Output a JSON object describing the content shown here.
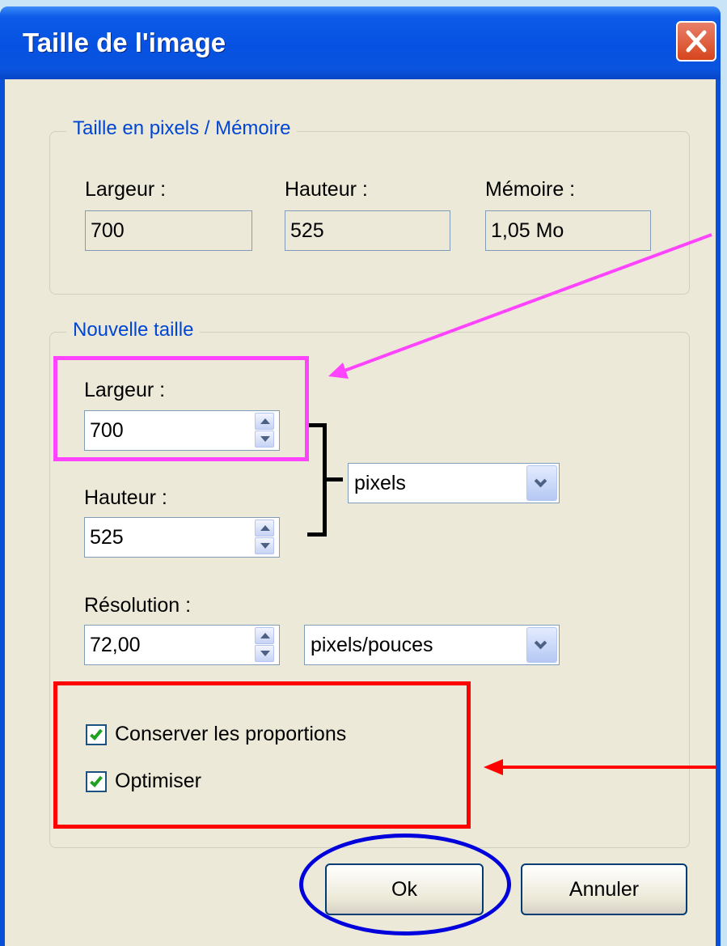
{
  "window": {
    "title": "Taille de l'image"
  },
  "pixel_size_group": {
    "legend": "Taille en pixels / Mémoire",
    "width_label": "Largeur :",
    "width_value": "700",
    "height_label": "Hauteur :",
    "height_value": "525",
    "memory_label": "Mémoire :",
    "memory_value": "1,05 Mo"
  },
  "new_size_group": {
    "legend": "Nouvelle taille",
    "width_label": "Largeur :",
    "width_value": "700",
    "height_label": "Hauteur :",
    "height_value": "525",
    "unit_selected": "pixels",
    "resolution_label": "Résolution :",
    "resolution_value": "72,00",
    "resolution_unit_selected": "pixels/pouces"
  },
  "options": {
    "keep_proportions_label": "Conserver les proportions",
    "keep_proportions_checked": true,
    "optimize_label": "Optimiser",
    "optimize_checked": true
  },
  "buttons": {
    "ok_label": "Ok",
    "cancel_label": "Annuler"
  },
  "annotations": {
    "magenta_color": "#ff44ff",
    "red_color": "#ff0000",
    "blue_color": "#0000dd"
  },
  "icons": {
    "close": "close-icon",
    "spin_up": "arrow-up-icon",
    "spin_down": "arrow-down-icon",
    "dropdown": "chevron-down-icon",
    "check": "checkmark-icon"
  }
}
